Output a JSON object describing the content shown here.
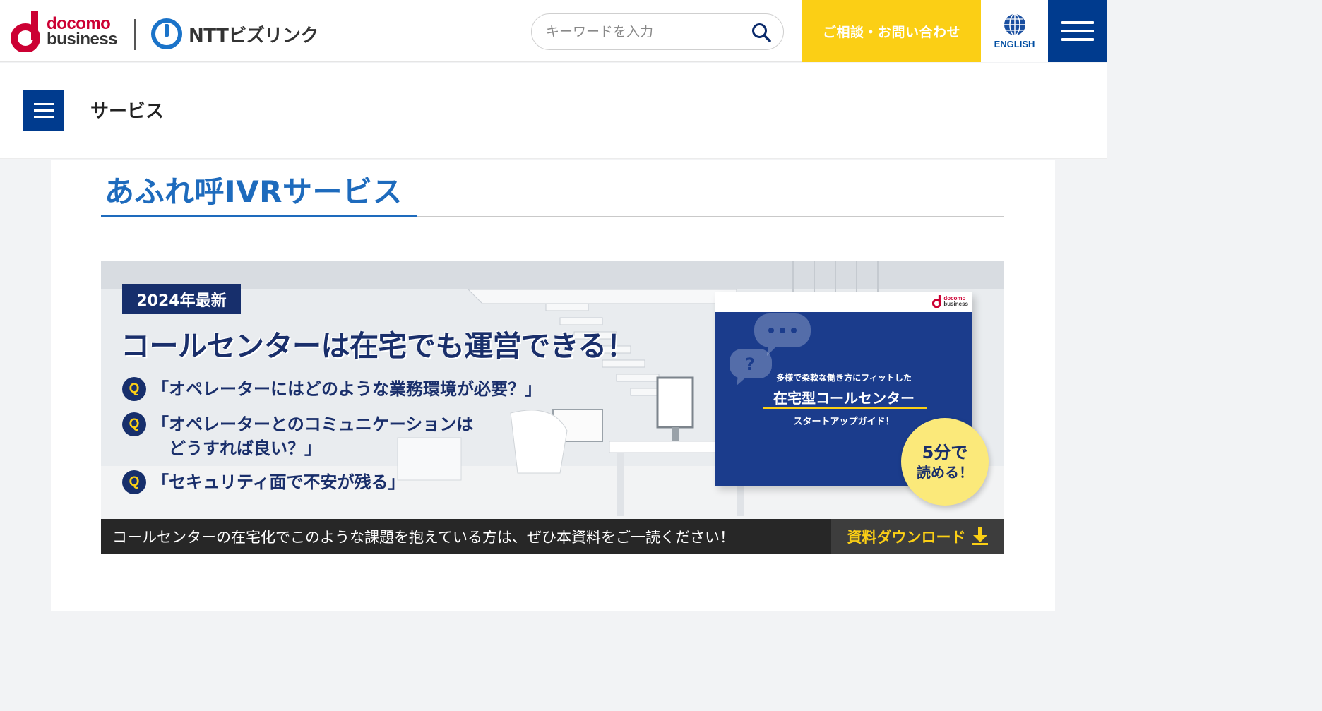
{
  "header": {
    "logo_docomo_line1": "docomo",
    "logo_docomo_line2": "business",
    "logo_ntt": "NTTビズリンク",
    "search_placeholder": "キーワードを入力",
    "contact_label": "ご相談・お問い合わせ",
    "english_label": "ENGLISH",
    "icons": [
      "search-icon",
      "globe-icon",
      "hamburger-menu-icon"
    ],
    "colors": {
      "brand_blue": "#003b8e",
      "contact_yellow": "#fbcf15",
      "docomo_red": "#cc0033"
    }
  },
  "subnav": {
    "title": "サービス"
  },
  "main": {
    "page_title": "あふれ呼IVRサービス",
    "title_color": "#1e6bbd"
  },
  "banner": {
    "tag": "2024年最新",
    "headline": "コールセンターは在宅でも運営できる！",
    "questions": [
      {
        "badge": "Q",
        "text": "「オペレーターにはどのような業務環境が必要？」"
      },
      {
        "badge": "Q",
        "text": "「オペレーターとのコミュニケーションは\n　どうすれば良い？」"
      },
      {
        "badge": "Q",
        "text": "「セキュリティ面で不安が残る」"
      }
    ],
    "guide": {
      "logo_line1": "docomo",
      "logo_line2": "business",
      "subtitle": "多様で柔軟な働き方にフィットした",
      "title": "在宅型コールセンター",
      "subtitle2": "スタートアップガイド！"
    },
    "badge_line1": "5分で",
    "badge_line2": "読める！",
    "footer_text": "コールセンターの在宅化でこのような課題を抱えている方は、ぜひ本資料をご一読ください！",
    "download_label": "資料ダウンロード"
  }
}
